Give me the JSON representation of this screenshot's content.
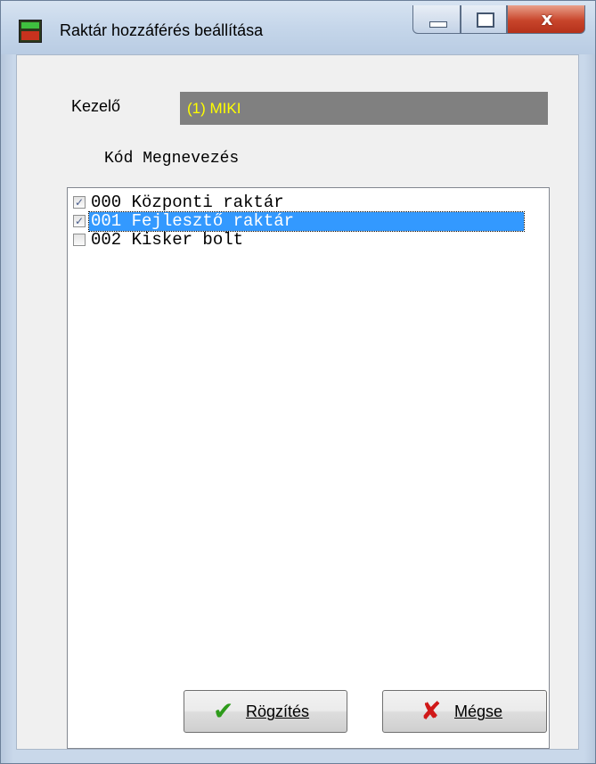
{
  "window": {
    "title": "Raktár hozzáférés beállítása",
    "close_glyph": "x"
  },
  "form": {
    "kezelo_label": "Kezelő",
    "kezelo_value": "(1) MIKI"
  },
  "list": {
    "header": "Kód Megnevezés",
    "items": [
      {
        "text": "000 Központi raktár",
        "checked": true,
        "selected": false
      },
      {
        "text": "001 Fejlesztő raktár",
        "checked": true,
        "selected": true
      },
      {
        "text": "002 Kisker bolt",
        "checked": false,
        "selected": false
      }
    ]
  },
  "buttons": {
    "ok_label": "Rögzítés",
    "cancel_label": "Mégse",
    "ok_icon": "checkmark-icon",
    "cancel_icon": "x-icon"
  },
  "colors": {
    "selection": "#3399ff",
    "kezelo_bg": "#808080",
    "kezelo_text": "#ffff00"
  }
}
